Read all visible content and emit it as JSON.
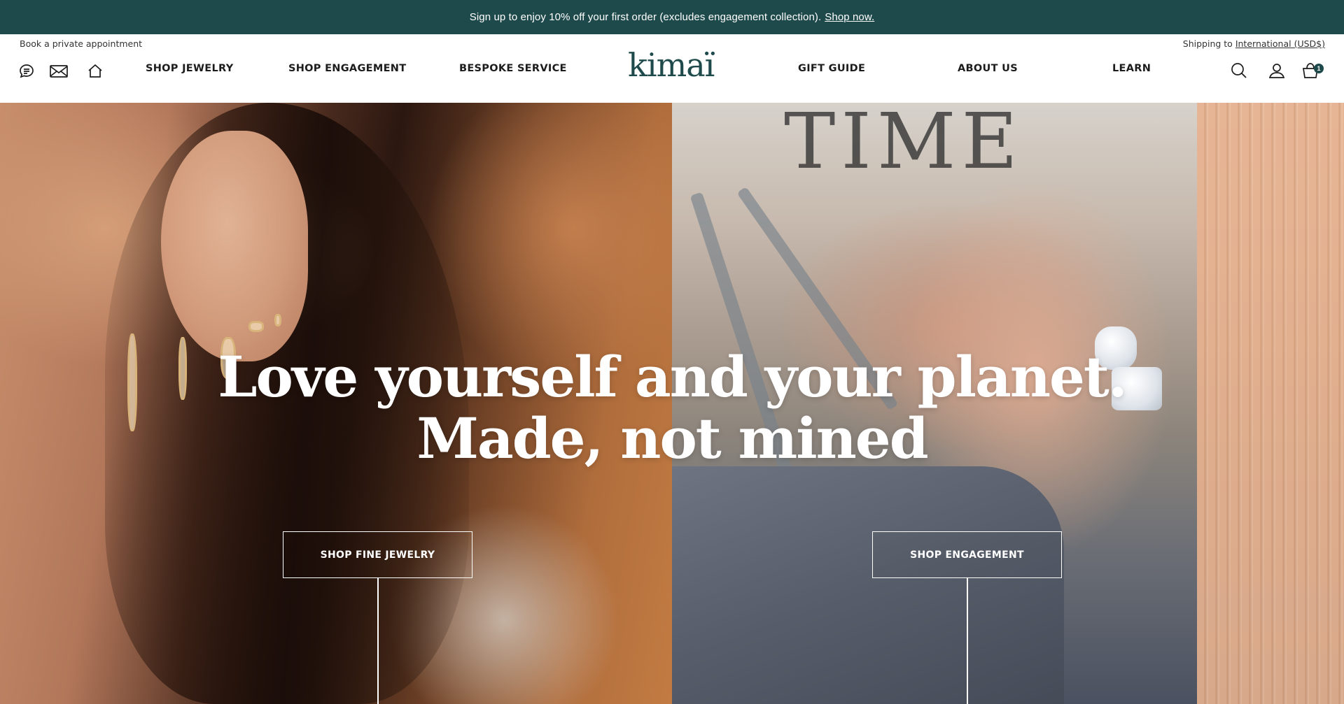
{
  "announcement": {
    "text": "Sign up to enjoy 10% off your first order (excludes engagement collection).",
    "link": "Shop now."
  },
  "utility": {
    "appointment": "Book a private appointment",
    "shipping_prefix": "Shipping to",
    "shipping_region": "International (USD$)"
  },
  "nav": {
    "left": [
      "SHOP JEWELRY",
      "SHOP ENGAGEMENT",
      "BESPOKE SERVICE"
    ],
    "right": [
      "GIFT GUIDE",
      "ABOUT US",
      "LEARN"
    ]
  },
  "logo": "kimaï",
  "icons": {
    "chat": "chat-icon",
    "mail": "mail-icon",
    "home": "home-icon",
    "search": "search-icon",
    "account": "account-icon",
    "cart": "cart-icon"
  },
  "cart_count": "1",
  "hero": {
    "line1": "Love yourself and your planet.",
    "line2": "Made, not mined",
    "cta_left": "SHOP FINE JEWELRY",
    "cta_right": "SHOP ENGAGEMENT",
    "backdrop_text": "TIME"
  },
  "colors": {
    "brand": "#1f4a4c",
    "text": "#1c1c1c"
  }
}
